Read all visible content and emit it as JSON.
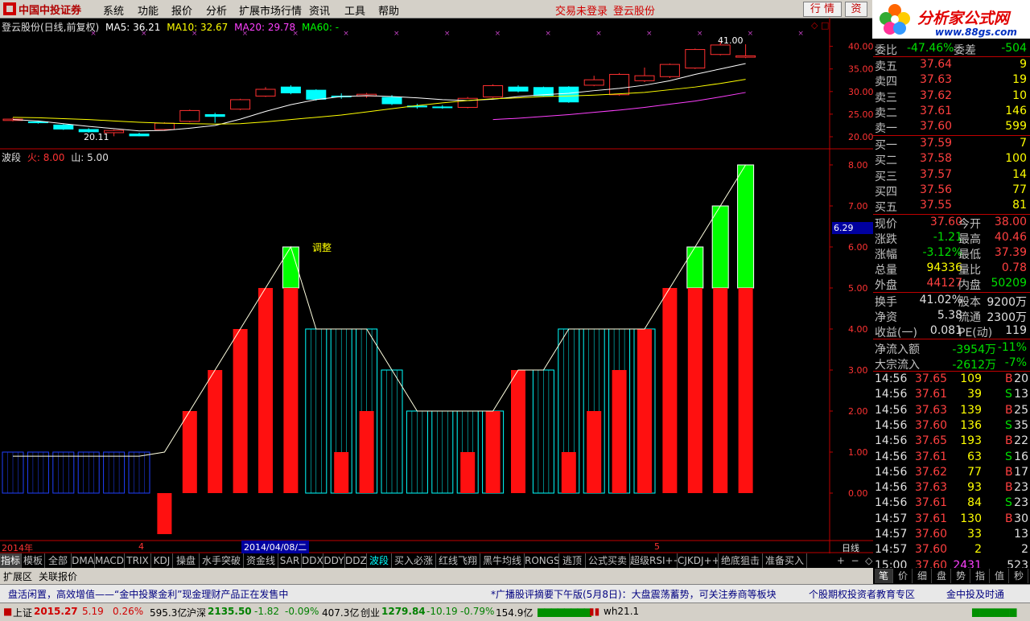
{
  "menu": {
    "logo_text": "中国中投证券",
    "items": [
      "系统",
      "功能",
      "报价",
      "分析",
      "扩展市场行情",
      "资讯",
      "工具",
      "帮助"
    ],
    "login_warning": "交易未登录",
    "stock_name": "登云股份",
    "btn_quote": "行 情",
    "btn_info": "资"
  },
  "brand": {
    "title": "分析家公式网",
    "url": "www.88gs.com"
  },
  "chart_header": {
    "title": "登云股份(日线,前复权)",
    "ma5": "MA5: 36.21",
    "ma10": "MA10: 32.67",
    "ma20": "MA20: 29.78",
    "ma60": "MA60: -"
  },
  "indicator_header": {
    "name": "波段",
    "fire": "火: 8.00",
    "mountain": "山: 5.00"
  },
  "annotations": {
    "adjust": "调整",
    "high_label": "41.00",
    "low_label": "20.11",
    "cursor_value": "6.29"
  },
  "colors": {
    "up": "#ff3030",
    "down": "#00ffff",
    "green": "#00ff00",
    "ma5": "#ffffff",
    "ma10": "#ffff00",
    "ma20": "#ff40ff",
    "separator": "#c00000"
  },
  "chart_data": [
    {
      "type": "candlestick",
      "ylim": [
        20,
        41
      ],
      "yticks": [
        20.0,
        25.0,
        30.0,
        35.0,
        40.0
      ],
      "candles": [
        {
          "o": 23.6,
          "c": 23.9,
          "h": 24.2,
          "l": 23.4
        },
        {
          "o": 23.3,
          "c": 23.1,
          "h": 23.5,
          "l": 22.9
        },
        {
          "o": 22.6,
          "c": 21.7,
          "h": 22.8,
          "l": 21.5
        },
        {
          "o": 21.6,
          "c": 21.1,
          "h": 21.9,
          "l": 20.9
        },
        {
          "o": 20.9,
          "c": 21.4,
          "h": 21.6,
          "l": 20.11
        },
        {
          "o": 20.6,
          "c": 20.2,
          "h": 20.9,
          "l": 20.11
        },
        {
          "o": 21.6,
          "c": 23.0,
          "h": 23.2,
          "l": 21.4
        },
        {
          "o": 23.4,
          "c": 25.8,
          "h": 26.0,
          "l": 23.2
        },
        {
          "o": 24.9,
          "c": 24.5,
          "h": 25.3,
          "l": 23.1
        },
        {
          "o": 26.1,
          "c": 28.2,
          "h": 28.4,
          "l": 25.9
        },
        {
          "o": 29.0,
          "c": 30.5,
          "h": 31.0,
          "l": 28.8
        },
        {
          "o": 31.0,
          "c": 29.7,
          "h": 31.4,
          "l": 29.4
        },
        {
          "o": 30.3,
          "c": 28.3,
          "h": 30.5,
          "l": 28.0
        },
        {
          "o": 29.0,
          "c": 28.9,
          "h": 29.6,
          "l": 28.4
        },
        {
          "o": 29.0,
          "c": 29.4,
          "h": 29.7,
          "l": 28.6
        },
        {
          "o": 28.7,
          "c": 27.3,
          "h": 29.2,
          "l": 27.0
        },
        {
          "o": 26.8,
          "c": 26.6,
          "h": 27.3,
          "l": 26.2
        },
        {
          "o": 26.6,
          "c": 26.5,
          "h": 27.0,
          "l": 26.2
        },
        {
          "o": 26.5,
          "c": 28.5,
          "h": 28.8,
          "l": 26.3
        },
        {
          "o": 28.8,
          "c": 31.3,
          "h": 31.6,
          "l": 28.6
        },
        {
          "o": 31.0,
          "c": 30.1,
          "h": 31.4,
          "l": 29.8
        },
        {
          "o": 30.9,
          "c": 29.1,
          "h": 31.1,
          "l": 28.9
        },
        {
          "o": 31.0,
          "c": 27.7,
          "h": 31.2,
          "l": 27.5
        },
        {
          "o": 31.4,
          "c": 32.6,
          "h": 33.5,
          "l": 31.2
        },
        {
          "o": 29.3,
          "c": 33.8,
          "h": 34.1,
          "l": 29.1
        },
        {
          "o": 32.4,
          "c": 33.5,
          "h": 35.3,
          "l": 32.1
        },
        {
          "o": 33.3,
          "c": 36.0,
          "h": 36.2,
          "l": 33.0
        },
        {
          "o": 35.2,
          "c": 39.3,
          "h": 39.5,
          "l": 35.0
        },
        {
          "o": 38.2,
          "c": 40.3,
          "h": 41.0,
          "l": 38.0
        },
        {
          "o": 37.6,
          "c": 37.9,
          "h": 40.46,
          "l": 37.39
        }
      ],
      "ma5": [
        23.8,
        23.5,
        22.9,
        22.3,
        21.8,
        21.3,
        21.4,
        21.9,
        22.5,
        23.9,
        25.6,
        27.1,
        28.2,
        28.9,
        29.1,
        28.9,
        28.6,
        28.2,
        28.0,
        28.3,
        28.9,
        29.3,
        29.6,
        30.2,
        30.7,
        31.4,
        32.4,
        33.8,
        35.0,
        36.2
      ],
      "ma10": [
        24.3,
        24.2,
        24.0,
        23.8,
        23.5,
        23.2,
        23.0,
        22.9,
        22.8,
        22.9,
        23.3,
        23.8,
        24.3,
        24.8,
        25.5,
        26.2,
        26.9,
        27.5,
        28.0,
        28.4,
        28.6,
        28.9,
        29.0,
        29.2,
        29.5,
        29.8,
        30.4,
        31.0,
        31.8,
        32.7
      ],
      "ma20": [
        null,
        null,
        null,
        null,
        null,
        null,
        null,
        null,
        null,
        null,
        null,
        null,
        null,
        null,
        null,
        null,
        null,
        null,
        null,
        23.8,
        24.1,
        24.5,
        24.9,
        25.4,
        25.9,
        26.5,
        27.2,
        27.9,
        28.8,
        29.8
      ]
    },
    {
      "type": "bar",
      "name": "波段",
      "ylim": [
        -1,
        8.5
      ],
      "yticks": [
        0.0,
        1.0,
        2.0,
        3.0,
        4.0,
        5.0,
        6.0,
        7.0,
        8.0
      ],
      "red": [
        0,
        0,
        0,
        0,
        0,
        0,
        -1,
        2,
        3,
        4,
        5,
        5,
        0,
        1,
        2,
        0,
        0,
        0,
        1,
        2,
        3,
        0,
        1,
        2,
        3,
        4,
        5,
        5,
        5,
        5
      ],
      "cyan": [
        1,
        1,
        1,
        1,
        1,
        1,
        0,
        0,
        0,
        0,
        0,
        0,
        4,
        4,
        4,
        3,
        2,
        2,
        2,
        2,
        0,
        3,
        4,
        4,
        4,
        4,
        0,
        0,
        0,
        0
      ],
      "green": [
        0,
        0,
        0,
        0,
        0,
        0,
        0,
        0,
        0,
        0,
        0,
        6,
        0,
        0,
        0,
        0,
        0,
        0,
        0,
        0,
        0,
        0,
        0,
        0,
        0,
        0,
        0,
        6,
        7,
        8
      ],
      "line": [
        0.9,
        0.9,
        0.9,
        0.9,
        0.9,
        0.9,
        1,
        2,
        3,
        4,
        5,
        6,
        4,
        4,
        4,
        3,
        2,
        2,
        2,
        2,
        3,
        3,
        4,
        4,
        4,
        4,
        5,
        6,
        7,
        8
      ]
    }
  ],
  "xaxis": {
    "year": "2014年",
    "m4": "4",
    "cursor_date": "2014/04/08/二",
    "m5": "5",
    "period": "日线"
  },
  "tabs": [
    "指标",
    "模板",
    "全部",
    "DMA",
    "MACD",
    "TRIX",
    "KDJ",
    "操盘",
    "水手突破",
    "资金线",
    "SAR",
    "DDX",
    "DDY",
    "DDZ",
    "波段",
    "买入必涨",
    "红线飞翔",
    "黑牛均线",
    "RONGS",
    "逃顶",
    "公式买卖",
    "超级RSI++",
    "CJKDJ++",
    "绝底狙击",
    "准备买入"
  ],
  "subtabs": [
    "扩展区",
    "关联报价"
  ],
  "quote": {
    "top_label": "委比",
    "top_pct": "-47.46%",
    "top_label2": "委差",
    "top_val": "-504",
    "sells": [
      {
        "label": "卖五",
        "price": "37.64",
        "vol": "9"
      },
      {
        "label": "卖四",
        "price": "37.63",
        "vol": "19"
      },
      {
        "label": "卖三",
        "price": "37.62",
        "vol": "10"
      },
      {
        "label": "卖二",
        "price": "37.61",
        "vol": "146"
      },
      {
        "label": "卖一",
        "price": "37.60",
        "vol": "599"
      }
    ],
    "buys": [
      {
        "label": "买一",
        "price": "37.59",
        "vol": "7"
      },
      {
        "label": "买二",
        "price": "37.58",
        "vol": "100"
      },
      {
        "label": "买三",
        "price": "37.57",
        "vol": "14"
      },
      {
        "label": "买四",
        "price": "37.56",
        "vol": "77"
      },
      {
        "label": "买五",
        "price": "37.55",
        "vol": "81"
      }
    ],
    "stats": [
      {
        "l1": "现价",
        "v1": "37.60",
        "l2": "今开",
        "v2": "38.00"
      },
      {
        "l1": "涨跌",
        "v1": "-1.21",
        "l2": "最高",
        "v2": "40.46"
      },
      {
        "l1": "涨幅",
        "v1": "-3.12%",
        "l2": "最低",
        "v2": "37.39"
      },
      {
        "l1": "总量",
        "v1": "94336",
        "l2": "量比",
        "v2": "0.78"
      },
      {
        "l1": "外盘",
        "v1": "44127",
        "l2": "内盘",
        "v2": "50209"
      }
    ],
    "stats2": [
      {
        "l1": "换手",
        "v1": "41.02%",
        "l2": "股本",
        "v2": "9200万"
      },
      {
        "l1": "净资",
        "v1": "5.38",
        "l2": "流通",
        "v2": "2300万"
      },
      {
        "l1": "收益(一)",
        "v1": "0.081",
        "l2": "PE(动)",
        "v2": "119"
      }
    ],
    "flow": [
      {
        "label": "净流入额",
        "v1": "-3954万",
        "v2": "-11%"
      },
      {
        "label": "大宗流入",
        "v1": "-2612万",
        "v2": "-7%"
      }
    ],
    "ticks": [
      {
        "t": "14:56",
        "p": "37.65",
        "v": "109",
        "s": "B",
        "n": "20"
      },
      {
        "t": "14:56",
        "p": "37.61",
        "v": "39",
        "s": "S",
        "n": "13"
      },
      {
        "t": "14:56",
        "p": "37.63",
        "v": "139",
        "s": "B",
        "n": "25"
      },
      {
        "t": "14:56",
        "p": "37.60",
        "v": "136",
        "s": "S",
        "n": "35"
      },
      {
        "t": "14:56",
        "p": "37.65",
        "v": "193",
        "s": "B",
        "n": "22"
      },
      {
        "t": "14:56",
        "p": "37.61",
        "v": "63",
        "s": "S",
        "n": "16"
      },
      {
        "t": "14:56",
        "p": "37.62",
        "v": "77",
        "s": "B",
        "n": "17"
      },
      {
        "t": "14:56",
        "p": "37.63",
        "v": "93",
        "s": "B",
        "n": "23"
      },
      {
        "t": "14:56",
        "p": "37.61",
        "v": "84",
        "s": "S",
        "n": "23"
      },
      {
        "t": "14:57",
        "p": "37.61",
        "v": "130",
        "s": "B",
        "n": "30"
      },
      {
        "t": "14:57",
        "p": "37.60",
        "v": "33",
        "s": "",
        "n": "13"
      },
      {
        "t": "14:57",
        "p": "37.60",
        "v": "2",
        "s": "",
        "n": "2"
      },
      {
        "t": "15:00",
        "p": "37.60",
        "v": "2431",
        "s": "",
        "n": "523"
      }
    ]
  },
  "right_tabs": [
    "笔",
    "价",
    "细",
    "盘",
    "势",
    "指",
    "值",
    "秒"
  ],
  "news": [
    "盘活闲置，高效增值——“金中投聚金利”现金理财产品正在发售中",
    "*广播股评摘要下午版(5月8日)：大盘震荡蓄势，可关注券商等板块",
    "个股期权投资者教育专区",
    "金中投及时通"
  ],
  "status": {
    "sh_label": "上证",
    "sh_val": "2015.27",
    "sh_chg": "5.19",
    "sh_pct": "0.26%",
    "sh_amt": "595.3亿",
    "hs_label": "沪深",
    "hs_val": "2135.50",
    "hs_chg": "-1.82",
    "hs_pct": "-0.09%",
    "hs_amt": "407.3亿",
    "cy_label": "创业",
    "cy_val": "1279.84",
    "cy_chg": "-10.19",
    "cy_pct": "-0.79%",
    "cy_amt": "154.9亿",
    "server": "wh21.1"
  }
}
